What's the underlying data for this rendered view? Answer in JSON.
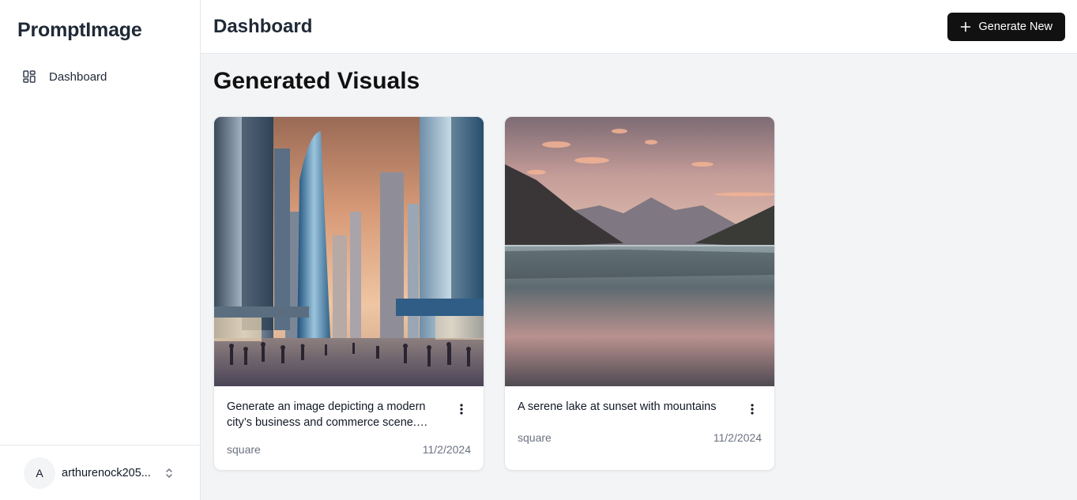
{
  "sidebar": {
    "brand": "PromptImage",
    "nav": [
      {
        "label": "Dashboard",
        "icon": "dashboard-grid-icon"
      }
    ],
    "user": {
      "initial": "A",
      "name": "arthurenock205..."
    }
  },
  "header": {
    "title": "Dashboard",
    "generate_label": "Generate New"
  },
  "main": {
    "section_title": "Generated Visuals",
    "cards": [
      {
        "prompt": "Generate an image depicting a modern city’s business and commerce scene. The image should show tall glass skyscrapers",
        "format": "square",
        "date": "11/2/2024",
        "image": "city-skyline-image"
      },
      {
        "prompt": "A serene lake at sunset with mountains",
        "format": "square",
        "date": "11/2/2024",
        "image": "lake-sunset-image"
      }
    ]
  },
  "colors": {
    "primary_button": "#111111",
    "main_background": "#f3f4f6",
    "muted_text": "#6b7280"
  }
}
